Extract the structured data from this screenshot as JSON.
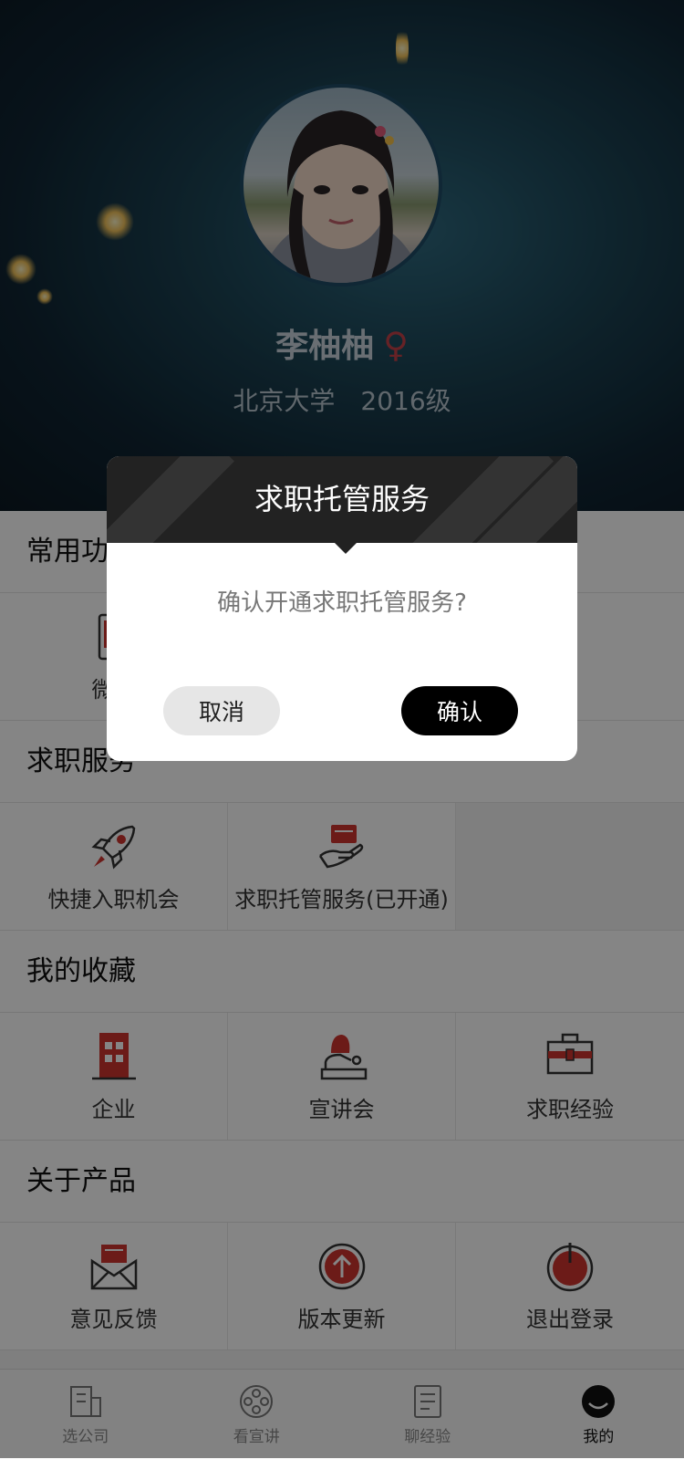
{
  "profile": {
    "name": "李柚柚",
    "gender_symbol": "♀",
    "school": "北京大学",
    "year": "2016级"
  },
  "sections": {
    "common": {
      "title": "常用功能",
      "items": [
        {
          "label": "微信",
          "icon": "phone-icon"
        }
      ]
    },
    "job_services": {
      "title": "求职服务",
      "items": [
        {
          "label": "快捷入职机会",
          "icon": "rocket-icon"
        },
        {
          "label": "求职托管服务(已开通)",
          "icon": "hand-card-icon"
        }
      ]
    },
    "favorites": {
      "title": "我的收藏",
      "items": [
        {
          "label": "企业",
          "icon": "building-icon"
        },
        {
          "label": "宣讲会",
          "icon": "speaker-icon"
        },
        {
          "label": "求职经验",
          "icon": "briefcase-icon"
        }
      ]
    },
    "about": {
      "title": "关于产品",
      "items": [
        {
          "label": "意见反馈",
          "icon": "mail-icon"
        },
        {
          "label": "版本更新",
          "icon": "upload-icon"
        },
        {
          "label": "退出登录",
          "icon": "power-icon"
        }
      ]
    }
  },
  "tabbar": {
    "items": [
      {
        "label": "选公司",
        "icon": "building-tab-icon"
      },
      {
        "label": "看宣讲",
        "icon": "film-reel-icon"
      },
      {
        "label": "聊经验",
        "icon": "document-icon"
      },
      {
        "label": "我的",
        "icon": "profile-icon"
      }
    ],
    "active_index": 3
  },
  "dialog": {
    "title": "求职托管服务",
    "message": "确认开通求职托管服务?",
    "cancel_label": "取消",
    "confirm_label": "确认"
  },
  "colors": {
    "accent_red": "#d0352f",
    "dialog_header": "#222222",
    "confirm_button": "#000000"
  }
}
